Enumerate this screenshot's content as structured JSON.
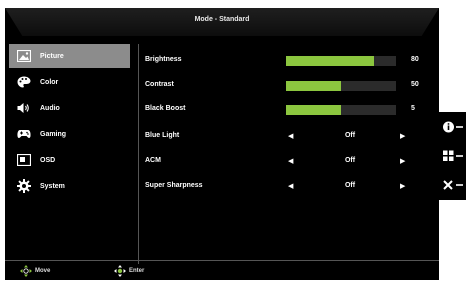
{
  "title": "Mode - Standard",
  "accent_color": "#8cc63f",
  "sidebar": {
    "items": [
      {
        "label": "Picture",
        "icon": "picture-icon",
        "active": true
      },
      {
        "label": "Color",
        "icon": "color-palette-icon",
        "active": false
      },
      {
        "label": "Audio",
        "icon": "speaker-icon",
        "active": false
      },
      {
        "label": "Gaming",
        "icon": "gamepad-icon",
        "active": false
      },
      {
        "label": "OSD",
        "icon": "osd-window-icon",
        "active": false
      },
      {
        "label": "System",
        "icon": "gear-icon",
        "active": false
      }
    ]
  },
  "settings": {
    "brightness": {
      "label": "Brightness",
      "value": "80",
      "level": 0.8
    },
    "contrast": {
      "label": "Contrast",
      "value": "50",
      "level": 0.5
    },
    "black_boost": {
      "label": "Black Boost",
      "value": "5",
      "level": 0.5
    },
    "blue_light": {
      "label": "Blue Light",
      "value": "Off"
    },
    "acm": {
      "label": "ACM",
      "value": "Off"
    },
    "super_sharpness": {
      "label": "Super Sharpness",
      "value": "Off"
    }
  },
  "footer": {
    "move_label": "Move",
    "enter_label": "Enter"
  },
  "side_keys": [
    "info-icon",
    "input-source-icon",
    "close-icon"
  ]
}
